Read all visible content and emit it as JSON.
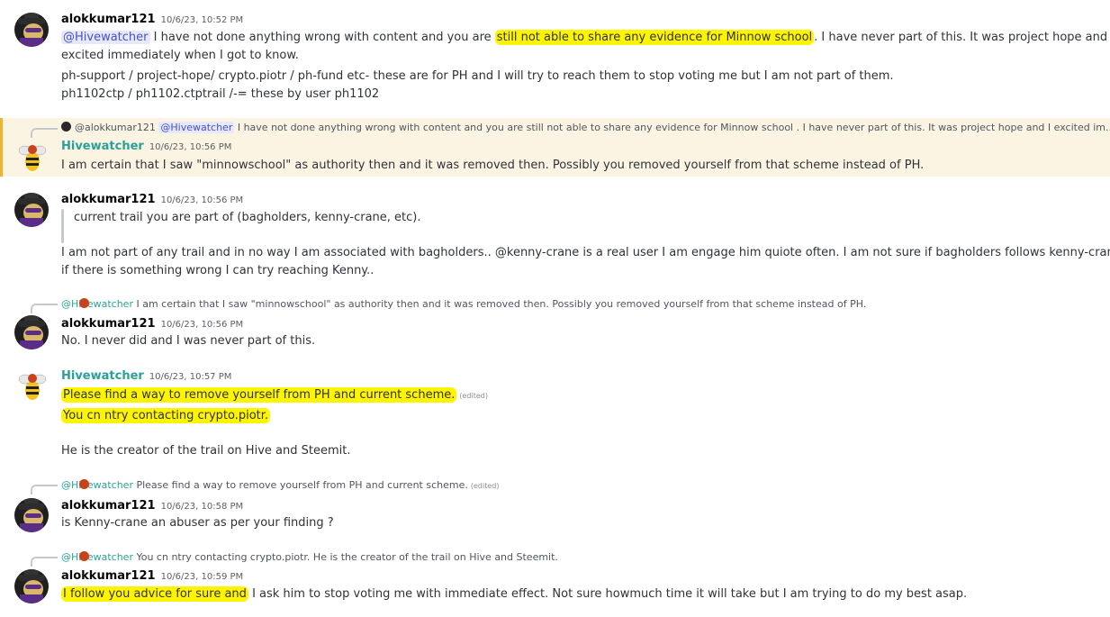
{
  "messages": [
    {
      "author": "alokkumar121",
      "time": "10/6/23, 10:52 PM",
      "line1_mention": "@Hivewatcher",
      "line1_a": " I have not done anything wrong with content and you are ",
      "line1_mark": "still not able to share any evidence for Minnow school",
      "line1_b": ". I have never part of this. It was project hope and I",
      "line2": "excited immediately when I got to know.",
      "line3": "ph-support / project-hope/  crypto.piotr / ph-fund etc- these are for PH and I will try to reach them to stop voting me but I am not part of them.",
      "line4": "ph1102ctp / ph1102.ctptrail /-= these by user ph1102"
    },
    {
      "reply_user": "@alokkumar121",
      "reply_mention": "@Hivewatcher",
      "reply_text": " I have not done anything wrong with content and you are still not able to share any evidence for Minnow school . I have never part of this. It was project hope and I excited im...",
      "author": "Hivewatcher",
      "time": "10/6/23, 10:56 PM",
      "text": "I am certain that I saw \"minnowschool\" as authority then and it was removed then. Possibly you removed yourself from that scheme instead of PH."
    },
    {
      "author": "alokkumar121",
      "time": "10/6/23, 10:56 PM",
      "quote": "current trail you are part of (bagholders, kenny-crane, etc).",
      "line1": "I am not part of any trail and in no way I am associated with bagholders.. @kenny-crane is a real user I am engage him quiote often. I am not sure if bagholders follows kenny-crane but",
      "line2": "if there is something wrong I can try reaching Kenny.."
    },
    {
      "reply_user": "@Hivewatcher",
      "reply_text": " I am certain that I saw \"minnowschool\" as authority then and it was removed then. Possibly you removed yourself from that scheme instead of PH.",
      "author": "alokkumar121",
      "time": "10/6/23, 10:56 PM",
      "text": "No. I never did and I was never part of this."
    },
    {
      "author": "Hivewatcher",
      "time": "10/6/23, 10:57 PM",
      "line1": "Please find a way to remove yourself from PH and current scheme.",
      "edited": "(edited)",
      "line2": "You cn ntry contacting crypto.piotr.",
      "line3": "He is the creator of the trail on Hive and Steemit."
    },
    {
      "reply_user": "@Hivewatcher",
      "reply_text": " Please find a way to remove yourself from PH and current scheme.",
      "reply_edited": "(edited)",
      "author": "alokkumar121",
      "time": "10/6/23, 10:58 PM",
      "text": "is Kenny-crane an abuser as per your finding ?"
    },
    {
      "reply_user": "@Hivewatcher",
      "reply_text": " You cn ntry contacting crypto.piotr.  He is the creator of the trail on Hive and Steemit.",
      "author": "alokkumar121",
      "time": "10/6/23, 10:59 PM",
      "text_mark": "I follow you advice for sure and",
      "text_rest": " I ask him to stop voting me with immediate effect. Not sure howmuch time it will take but I am trying to do my best asap."
    }
  ],
  "colors": {
    "highlight": "#fff400",
    "reply_highlight_bg": "#fbf4e3",
    "teal_name": "#2aa198",
    "mention_bg": "#e6e8fd"
  }
}
